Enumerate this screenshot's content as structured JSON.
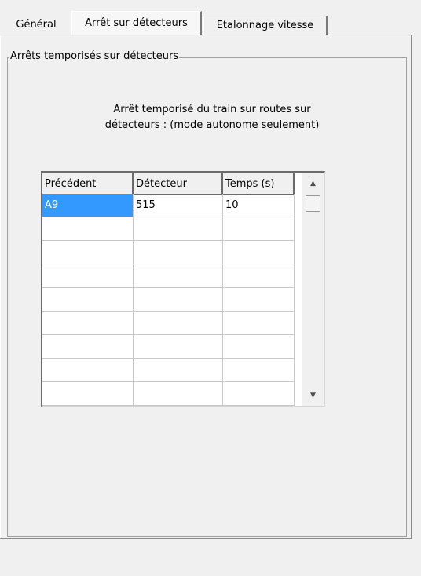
{
  "tabs": [
    {
      "label": "Général",
      "active": false
    },
    {
      "label": "Arrêt sur détecteurs",
      "active": true
    },
    {
      "label": "Etalonnage vitesse",
      "active": false
    }
  ],
  "group": {
    "title": "Arrêts temporisés sur détecteurs",
    "description_line1": "Arrêt temporisé du train sur routes sur",
    "description_line2": "détecteurs : (mode autonome seulement)"
  },
  "grid": {
    "columns": [
      "Précédent",
      "Détecteur",
      "Temps (s)"
    ],
    "rows": [
      [
        "A9",
        "515",
        "10"
      ],
      [
        "",
        "",
        ""
      ],
      [
        "",
        "",
        ""
      ],
      [
        "",
        "",
        ""
      ],
      [
        "",
        "",
        ""
      ],
      [
        "",
        "",
        ""
      ],
      [
        "",
        "",
        ""
      ],
      [
        "",
        "",
        ""
      ],
      [
        "",
        "",
        ""
      ]
    ],
    "selected_cell": [
      0,
      0
    ]
  },
  "scrollbar": {
    "up_icon": "▲",
    "down_icon": "▼"
  },
  "colors": {
    "background": "#f0f0f0",
    "selection": "#3399ff",
    "grid_line": "#c8c8c8"
  }
}
